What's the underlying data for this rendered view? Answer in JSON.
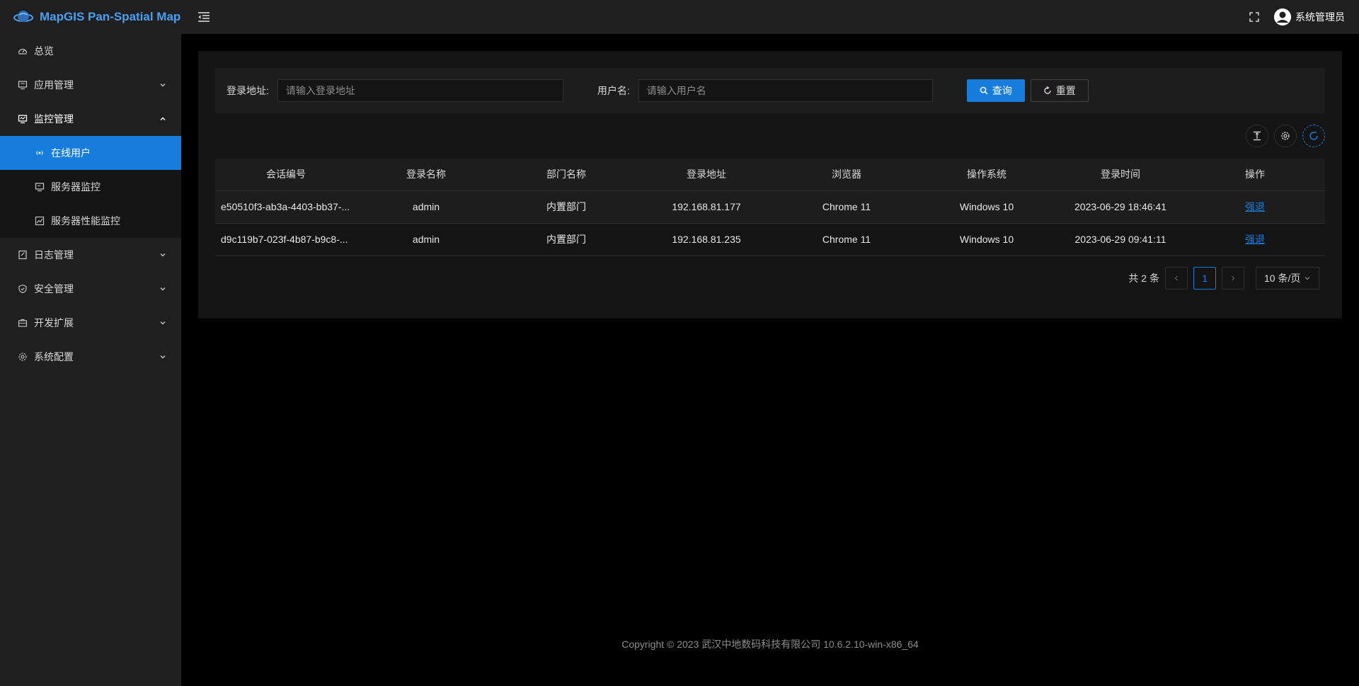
{
  "app": {
    "title": "MapGIS Pan-Spatial Map"
  },
  "sidebar": {
    "items": [
      {
        "label": "总览",
        "icon": "dashboard-icon"
      },
      {
        "label": "应用管理",
        "icon": "app-icon"
      },
      {
        "label": "监控管理",
        "icon": "monitor-icon"
      },
      {
        "label": "日志管理",
        "icon": "log-icon"
      },
      {
        "label": "安全管理",
        "icon": "shield-icon"
      },
      {
        "label": "开发扩展",
        "icon": "toolbox-icon"
      },
      {
        "label": "系统配置",
        "icon": "gear-icon"
      }
    ],
    "sub": [
      {
        "label": "在线用户",
        "icon": "broadcast-icon"
      },
      {
        "label": "服务器监控",
        "icon": "screen-icon"
      },
      {
        "label": "服务器性能监控",
        "icon": "line-chart-icon"
      }
    ]
  },
  "header": {
    "user": "系统管理员"
  },
  "search": {
    "addr_label": "登录地址:",
    "addr_placeholder": "请输入登录地址",
    "user_label": "用户名:",
    "user_placeholder": "请输入用户名",
    "query": "查询",
    "reset": "重置"
  },
  "table": {
    "columns": [
      "会话编号",
      "登录名称",
      "部门名称",
      "登录地址",
      "浏览器",
      "操作系统",
      "登录时间",
      "操作"
    ],
    "rows": [
      [
        "e50510f3-ab3a-4403-bb37-...",
        "admin",
        "内置部门",
        "192.168.81.177",
        "Chrome 11",
        "Windows 10",
        "2023-06-29 18:46:41",
        "强退"
      ],
      [
        "d9c119b7-023f-4b87-b9c8-...",
        "admin",
        "内置部门",
        "192.168.81.235",
        "Chrome 11",
        "Windows 10",
        "2023-06-29 09:41:11",
        "强退"
      ]
    ]
  },
  "pagination": {
    "total": "共 2 条",
    "current": "1",
    "page_size": "10 条/页"
  },
  "footer": {
    "text": "Copyright © 2023 武汉中地数码科技有限公司 10.6.2.10-win-x86_64"
  },
  "colors": {
    "accent": "#177ddc",
    "sidebar_bg": "#1f1f1f",
    "card_bg": "#141414"
  }
}
